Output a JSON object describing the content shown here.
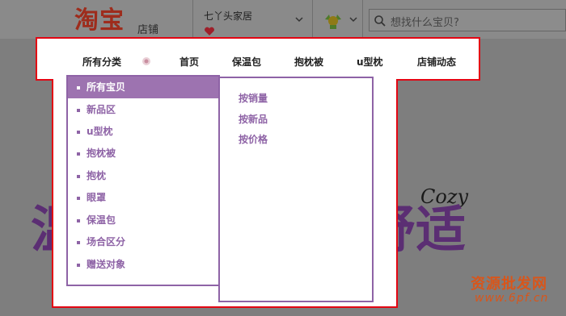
{
  "header": {
    "logo_text": "淘宝",
    "logo_sub": "店铺",
    "shop_name": "七丫头家居",
    "search_placeholder": "想找什么宝贝?"
  },
  "nav": {
    "items": [
      "所有分类",
      "首页",
      "保温包",
      "抱枕被",
      "u型枕",
      "店铺动态"
    ]
  },
  "categories": {
    "items": [
      "所有宝贝",
      "新品区",
      "u型枕",
      "抱枕被",
      "抱枕",
      "眼罩",
      "保温包",
      "场合区分",
      "赠送对象"
    ],
    "active_index": 0
  },
  "sort": {
    "items": [
      "按销量",
      "按新品",
      "按价格"
    ]
  },
  "banner": {
    "left_text": "温",
    "right_text": "舒适",
    "cozy_text": "Cozy"
  },
  "watermark": {
    "text": "资源批发网",
    "url": "www.6pf.cn"
  },
  "colors": {
    "accent": "#8e63a6",
    "active_bg": "#9d73b0",
    "highlight_border": "#e30613",
    "logo": "#9e2c1c"
  }
}
